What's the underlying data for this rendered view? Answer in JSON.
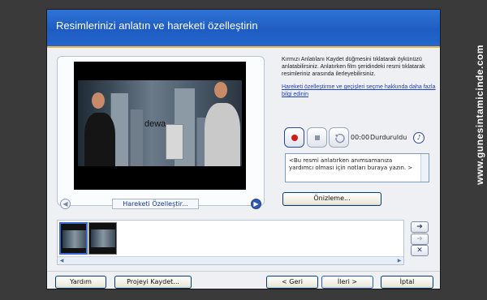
{
  "header": {
    "title": "Resimlerinizi anlatın ve hareketi özelleştirin"
  },
  "instructions": "Kırmızı Anlatılanı Kaydet düğmesini tıklatarak öykünüzü anlatabilirsiniz. Anlatırken film şeridindeki resmi tıklatarak resimleriniz arasında ilerleyebilirsiniz.",
  "help_link": "Hareketi özelleştirme ve geçişleri seçme hakkında daha fazla bilgi edinin",
  "preview": {
    "customize_button": "Hareketi Özelleştir...",
    "scene_caption": "dewa"
  },
  "narration": {
    "time": "00:00",
    "status": "Durduruldu",
    "notes": "<Bu resmi anlatırken anımsamanıza yardımcı olması için notları buraya yazın. >",
    "preview_button": "Önizleme...",
    "record_icon": "record-icon",
    "stop_icon": "stop-icon",
    "undo_icon": "undo-icon",
    "mic_icon": "microphone-icon"
  },
  "storyboard": {
    "thumbnail_count": 2
  },
  "footer": {
    "help": "Yardım",
    "save_project": "Projeyi Kaydet...",
    "back": "< Geri",
    "next": "İleri >",
    "cancel": "İptal"
  },
  "watermark": "www.gunesintamicinde.com",
  "colors": {
    "header": "#1e5cc2",
    "accent_rule": "#f0b84a",
    "record": "#d11a1a"
  }
}
